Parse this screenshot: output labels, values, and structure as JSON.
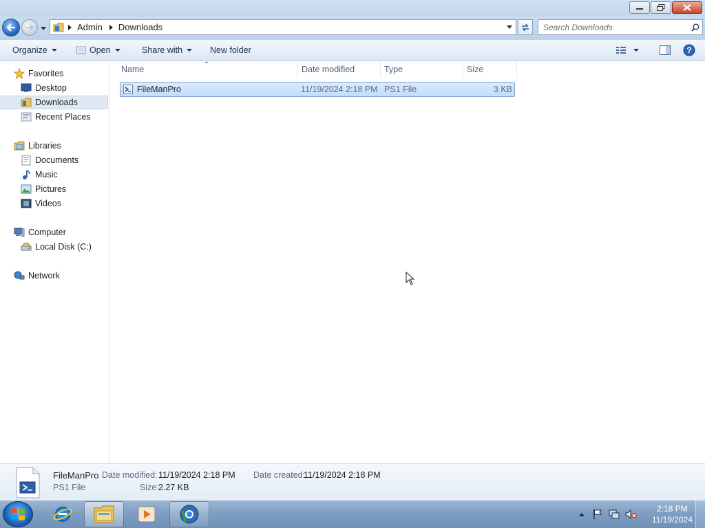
{
  "window": {
    "controls": [
      "minimize",
      "restore",
      "close"
    ]
  },
  "address": {
    "crumbs": [
      "Admin",
      "Downloads"
    ],
    "search_placeholder": "Search Downloads"
  },
  "toolbar": {
    "organize": "Organize",
    "open": "Open",
    "share_with": "Share with",
    "new_folder": "New folder"
  },
  "nav": {
    "favorites": "Favorites",
    "desktop": "Desktop",
    "downloads": "Downloads",
    "recent_places": "Recent Places",
    "libraries": "Libraries",
    "documents": "Documents",
    "music": "Music",
    "pictures": "Pictures",
    "videos": "Videos",
    "computer": "Computer",
    "local_disk": "Local Disk (C:)",
    "network": "Network"
  },
  "columns": {
    "name": "Name",
    "date_modified": "Date modified",
    "type": "Type",
    "size": "Size"
  },
  "files": [
    {
      "name": "FileManPro",
      "date_modified": "11/19/2024 2:18 PM",
      "type": "PS1 File",
      "size": "3 KB",
      "selected": true
    }
  ],
  "details": {
    "name": "FileManPro",
    "type": "PS1 File",
    "date_modified_label": "Date modified:",
    "date_modified": "11/19/2024 2:18 PM",
    "size_label": "Size:",
    "size": "2.27 KB",
    "date_created_label": "Date created:",
    "date_created": "11/19/2024 2:18 PM"
  },
  "taskbar": {
    "apps": [
      "internet-explorer",
      "windows-explorer",
      "media-player",
      "chrome-like-browser"
    ],
    "time": "2:18 PM",
    "date": "11/19/2024"
  }
}
